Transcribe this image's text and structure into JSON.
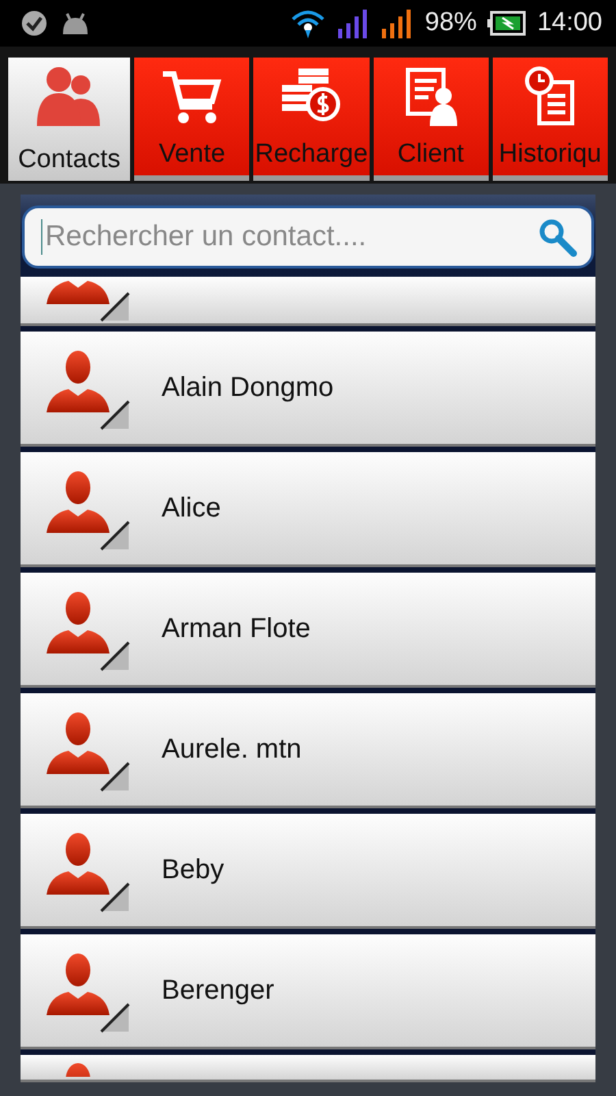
{
  "status_bar": {
    "battery": "98%",
    "time": "14:00"
  },
  "tabs": [
    {
      "label": "Contacts",
      "selected": true
    },
    {
      "label": "Vente",
      "selected": false
    },
    {
      "label": "Recharge",
      "selected": false
    },
    {
      "label": "Client",
      "selected": false
    },
    {
      "label": "Historiqu",
      "selected": false
    }
  ],
  "search": {
    "placeholder": "Rechercher un contact...."
  },
  "contacts": [
    {
      "name": "Alain Dongmo"
    },
    {
      "name": "Alice"
    },
    {
      "name": "Arman Flote"
    },
    {
      "name": "Aurele. mtn"
    },
    {
      "name": "Beby"
    },
    {
      "name": "Berenger"
    }
  ]
}
